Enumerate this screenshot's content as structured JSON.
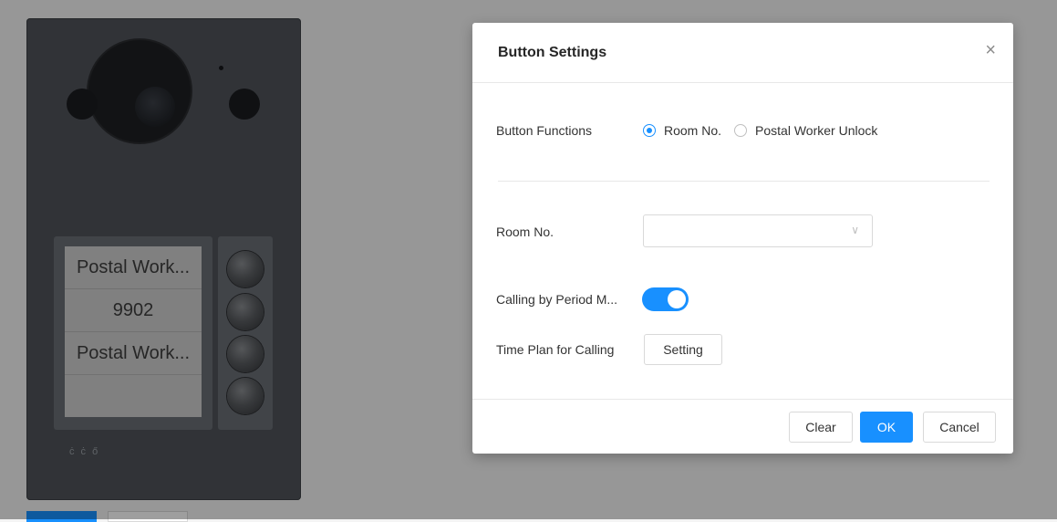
{
  "device": {
    "name_rows": [
      "Postal Work...",
      "9902",
      "Postal Work...",
      ""
    ],
    "button_count": 4,
    "mic_icons": "ċ ċ ő"
  },
  "dialog": {
    "title": "Button Settings",
    "close_icon": "×",
    "button_functions_label": "Button Functions",
    "radio_options": [
      {
        "label": "Room No.",
        "checked": true
      },
      {
        "label": "Postal Worker Unlock",
        "checked": false
      }
    ],
    "room_no_label": "Room No.",
    "room_no_value": "",
    "calling_by_period_label": "Calling by Period M...",
    "calling_by_period_enabled": true,
    "time_plan_label": "Time Plan for Calling",
    "setting_button": "Setting",
    "clear_button": "Clear",
    "ok_button": "OK",
    "cancel_button": "Cancel"
  },
  "colors": {
    "accent": "#1890ff",
    "device_body": "#4f5359"
  }
}
